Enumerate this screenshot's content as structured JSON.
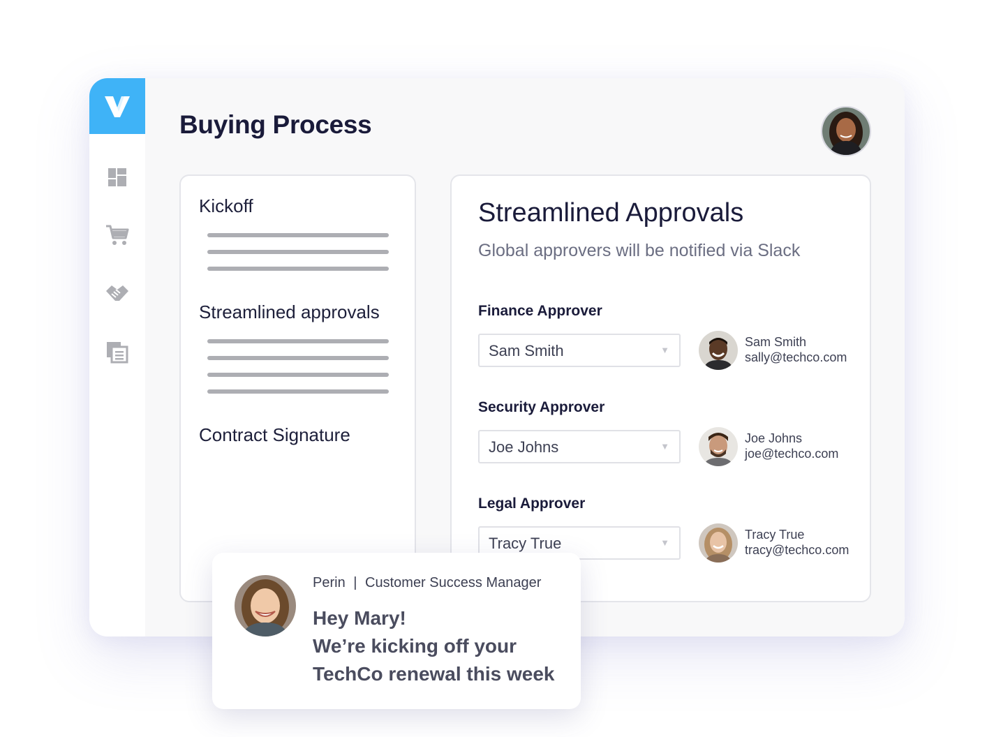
{
  "app": {
    "logo_letter": "V",
    "brand_color": "#3fb3f7",
    "nav_items": [
      {
        "name": "dashboard-icon"
      },
      {
        "name": "cart-icon"
      },
      {
        "name": "handshake-icon"
      },
      {
        "name": "documents-icon"
      }
    ]
  },
  "header": {
    "title": "Buying Process",
    "user_avatar": "user-avatar"
  },
  "steps": {
    "items": [
      {
        "label": "Kickoff",
        "lines": 3
      },
      {
        "label": "Streamlined approvals",
        "lines": 4
      },
      {
        "label": "Contract Signature",
        "lines": 0
      }
    ]
  },
  "approvals": {
    "title": "Streamlined Approvals",
    "subtitle": "Global approvers will be notified via Slack",
    "fields": [
      {
        "label": "Finance Approver",
        "value": "Sam Smith",
        "person_name": "Sam Smith",
        "person_email": "sally@techco.com"
      },
      {
        "label": "Security Approver",
        "value": "Joe Johns",
        "person_name": "Joe Johns",
        "person_email": "joe@techco.com"
      },
      {
        "label": "Legal Approver",
        "value": "Tracy True",
        "person_name": "Tracy True",
        "person_email": "tracy@techco.com"
      }
    ]
  },
  "chat": {
    "sender": "Perin",
    "separator": "|",
    "role": "Customer Success Manager",
    "message_lines": [
      "Hey Mary!",
      "We’re kicking off your",
      "TechCo renewal this week"
    ]
  }
}
